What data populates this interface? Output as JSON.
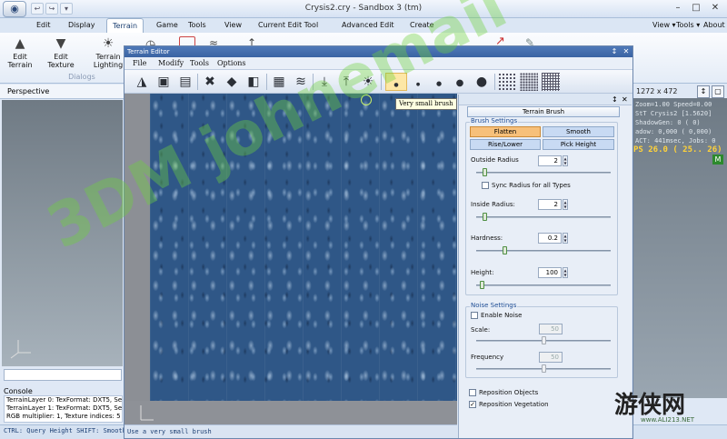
{
  "app": {
    "title": "Crysis2.cry - Sandbox 3 (tm)",
    "orb_icon": "sandbox-orb"
  },
  "quick_access": [
    "back-icon",
    "forward-icon",
    "dropdown-icon"
  ],
  "menu_tabs": [
    "Edit",
    "Display",
    "Terrain",
    "Game",
    "Tools",
    "View",
    "Current Edit Tool",
    "Advanced Edit",
    "Create"
  ],
  "active_tab": "Terrain",
  "right_menu": {
    "view": "View",
    "tools": "Tools",
    "about": "About"
  },
  "ribbon": {
    "buttons": [
      {
        "label": "Edit Terrain",
        "icon": "terrain-icon"
      },
      {
        "label": "Edit Texture",
        "icon": "texture-icon"
      },
      {
        "label": "Terrain Lighting",
        "icon": "sun-icon"
      }
    ],
    "group_label": "Dialogs"
  },
  "perspective": {
    "label": "Perspective"
  },
  "console": {
    "label": "Console",
    "lines": [
      "TerrainLayer 0: TexFormat: DXT5, Sector1",
      "TerrainLayer 1: TexFormat: DXT5, Sector1",
      "RGB multiplier: 1, Texture indices: 5"
    ]
  },
  "status": {
    "main": "CTRL: Query Height  SHIFT: Smooth",
    "editor": "Use a very small brush"
  },
  "viewport": {
    "size": "1272 x 472",
    "stats": [
      "Zoom=1.00 Speed=0.00",
      "StT Crysis2 [1.5620]",
      "ShadowGen: 0 ( 0)",
      "adow: 0,000 ( 0,000)",
      "ACT: 441msec, Jobs: 0",
      "489 DLights=(1/1/1/0)"
    ],
    "fps": "PS  26.0 ( 25.. 26)",
    "badge": "M"
  },
  "terrain_editor": {
    "title": "Terrain Editor",
    "menu": [
      "File",
      "Modify",
      "Tools",
      "Options"
    ],
    "toolbar": [
      "open-icon",
      "save-icon",
      "save-as-icon",
      "delete-icon",
      "erase-icon",
      "invert-icon",
      "noise-icon",
      "water-icon",
      "import-icon",
      "export-icon",
      "light-icon",
      "brush-tiny-icon",
      "brush-xsmall-icon",
      "brush-small-icon",
      "brush-medium-icon",
      "brush-large-icon",
      "brush-grid-small-icon",
      "brush-grid-medium-icon",
      "brush-grid-large-icon"
    ],
    "tooltip": "Very small brush",
    "brush": {
      "panel_title": "Terrain Brush",
      "settings_label": "Brush Settings",
      "modes": {
        "flatten": "Flatten",
        "smooth": "Smooth",
        "raise_lower": "Rise/Lower",
        "pick_height": "Pick Height"
      },
      "active_mode": "Flatten",
      "outside_radius": {
        "label": "Outside Radius",
        "value": "2",
        "level": 0.05
      },
      "sync_label": "Sync Radius for all Types",
      "inside_radius": {
        "label": "Inside Radius:",
        "value": "2",
        "level": 0.05
      },
      "hardness": {
        "label": "Hardness:",
        "value": "0.2",
        "level": 0.2
      },
      "height": {
        "label": "Height:",
        "value": "100",
        "level": 0.03
      },
      "noise_label": "Noise Settings",
      "enable_noise": "Enable Noise",
      "scale": {
        "label": "Scale:",
        "value": "50",
        "level": 0.5
      },
      "frequency": {
        "label": "Frequency",
        "value": "50",
        "level": 0.5
      },
      "reposition_objects": "Reposition Objects",
      "reposition_vegetation": "Reposition Vegetation"
    }
  },
  "watermark": {
    "text": "3DM johnemail",
    "site_logo": "游侠网",
    "site": "www.ALI213.NET"
  }
}
